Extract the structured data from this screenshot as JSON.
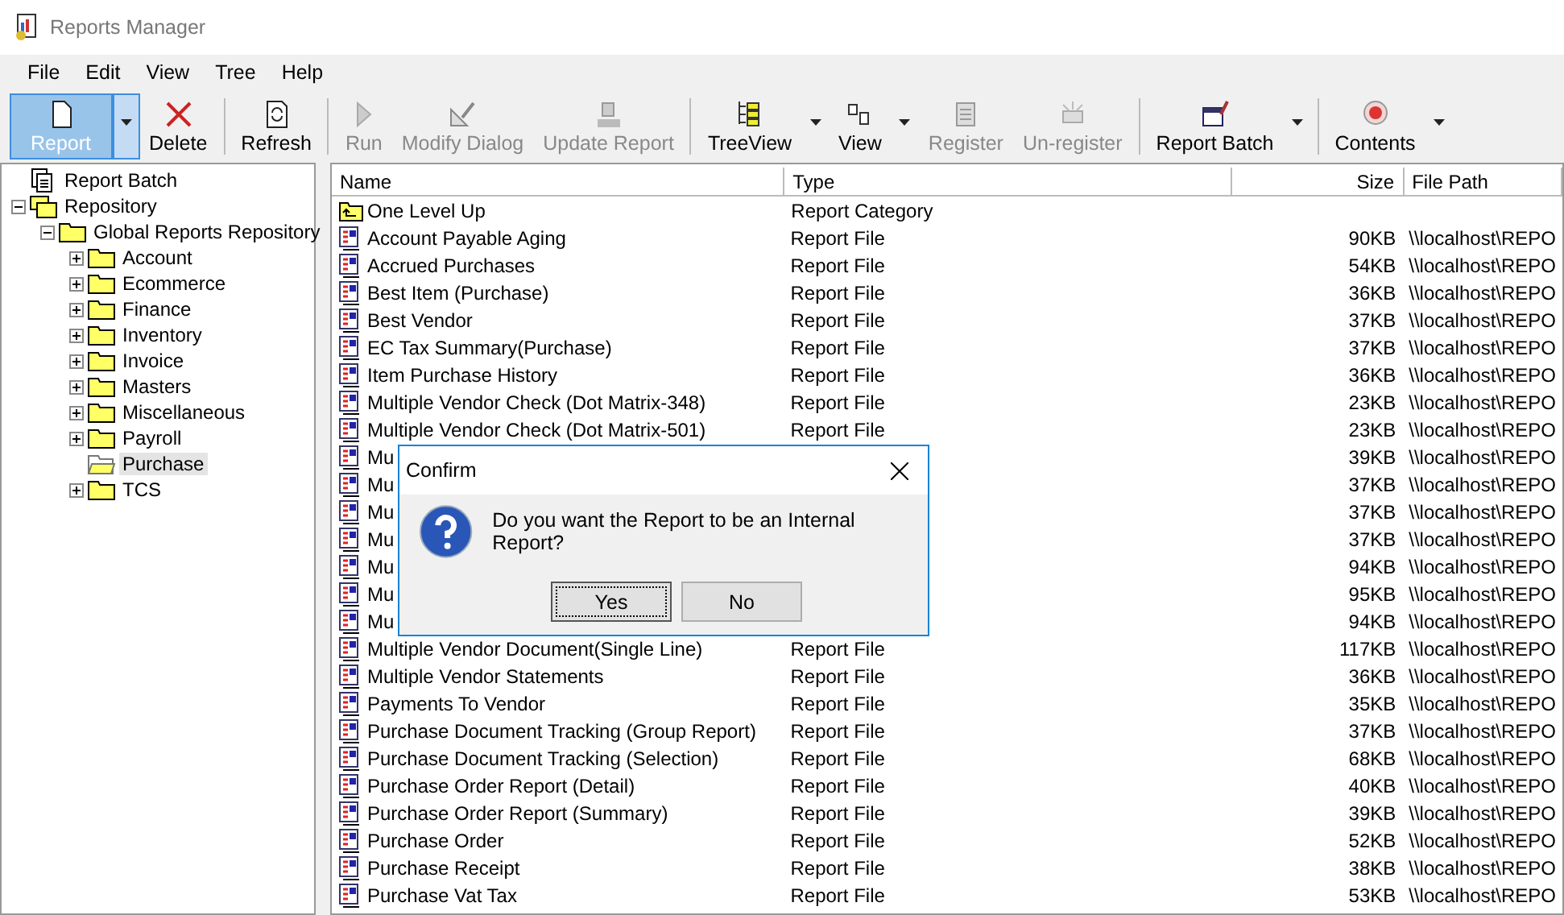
{
  "window": {
    "title": "Reports Manager"
  },
  "menu": [
    "File",
    "Edit",
    "View",
    "Tree",
    "Help"
  ],
  "toolbar": [
    [
      {
        "label": "Report",
        "disabled": false,
        "selected": true,
        "dropdown": true
      },
      {
        "label": "Delete",
        "disabled": false,
        "selected": false,
        "dropdown": false
      }
    ],
    [
      {
        "label": "Refresh",
        "disabled": false,
        "selected": false,
        "dropdown": false
      }
    ],
    [
      {
        "label": "Run",
        "disabled": true,
        "selected": false,
        "dropdown": false
      },
      {
        "label": "Modify Dialog",
        "disabled": true,
        "selected": false,
        "dropdown": false
      },
      {
        "label": "Update Report",
        "disabled": true,
        "selected": false,
        "dropdown": false
      }
    ],
    [
      {
        "label": "TreeView",
        "disabled": false,
        "selected": false,
        "dropdown": true
      },
      {
        "label": "View",
        "disabled": false,
        "selected": false,
        "dropdown": true
      },
      {
        "label": "Register",
        "disabled": true,
        "selected": false,
        "dropdown": false
      },
      {
        "label": "Un-register",
        "disabled": true,
        "selected": false,
        "dropdown": false
      }
    ],
    [
      {
        "label": "Report Batch",
        "disabled": false,
        "selected": false,
        "dropdown": true
      }
    ],
    [
      {
        "label": "Contents",
        "disabled": false,
        "selected": false,
        "dropdown": true
      }
    ]
  ],
  "tree": [
    {
      "label": "Report Batch",
      "kind": "batch",
      "selected": false
    },
    {
      "label": "Repository",
      "kind": "repository",
      "expanded": true,
      "selected": false,
      "children": [
        {
          "label": "Global Reports Repository",
          "kind": "folder",
          "expanded": true,
          "selected": false,
          "children": [
            {
              "label": "Account",
              "kind": "folder",
              "expanded": false,
              "selected": false
            },
            {
              "label": "Ecommerce",
              "kind": "folder",
              "expanded": false,
              "selected": false
            },
            {
              "label": "Finance",
              "kind": "folder",
              "expanded": false,
              "selected": false
            },
            {
              "label": "Inventory",
              "kind": "folder",
              "expanded": false,
              "selected": false
            },
            {
              "label": "Invoice",
              "kind": "folder",
              "expanded": false,
              "selected": false
            },
            {
              "label": "Masters",
              "kind": "folder",
              "expanded": false,
              "selected": false
            },
            {
              "label": "Miscellaneous",
              "kind": "folder",
              "expanded": false,
              "selected": false
            },
            {
              "label": "Payroll",
              "kind": "folder",
              "expanded": false,
              "selected": false
            },
            {
              "label": "Purchase",
              "kind": "folder",
              "expanded": true,
              "selected": true
            },
            {
              "label": "TCS",
              "kind": "folder",
              "expanded": false,
              "selected": false
            }
          ]
        }
      ]
    }
  ],
  "table": {
    "columns": [
      "Name",
      "Type",
      "Size",
      "File Path"
    ],
    "rows": [
      {
        "kind": "category",
        "name": "One Level Up",
        "type": "Report Category"
      },
      {
        "kind": "file",
        "name": "Account Payable Aging",
        "type": "Report File",
        "size": "90KB",
        "path": "\\\\localhost\\REPO"
      },
      {
        "kind": "file",
        "name": "Accrued Purchases",
        "type": "Report File",
        "size": "54KB",
        "path": "\\\\localhost\\REPO"
      },
      {
        "kind": "file",
        "name": "Best Item (Purchase)",
        "type": "Report File",
        "size": "36KB",
        "path": "\\\\localhost\\REPO"
      },
      {
        "kind": "file",
        "name": "Best Vendor",
        "type": "Report File",
        "size": "37KB",
        "path": "\\\\localhost\\REPO"
      },
      {
        "kind": "file",
        "name": "EC Tax Summary(Purchase)",
        "type": "Report File",
        "size": "37KB",
        "path": "\\\\localhost\\REPO"
      },
      {
        "kind": "file",
        "name": "Item Purchase History",
        "type": "Report File",
        "size": "36KB",
        "path": "\\\\localhost\\REPO"
      },
      {
        "kind": "file",
        "name": "Multiple Vendor Check (Dot Matrix-348)",
        "type": "Report File",
        "size": "23KB",
        "path": "\\\\localhost\\REPO"
      },
      {
        "kind": "file",
        "name": "Multiple Vendor Check (Dot Matrix-501)",
        "type": "Report File",
        "size": "23KB",
        "path": "\\\\localhost\\REPO"
      },
      {
        "kind": "file",
        "name": "Mu",
        "size": "39KB",
        "path": "\\\\localhost\\REPO"
      },
      {
        "kind": "file",
        "name": "Mu",
        "size": "37KB",
        "path": "\\\\localhost\\REPO"
      },
      {
        "kind": "file",
        "name": "Mu",
        "size": "37KB",
        "path": "\\\\localhost\\REPO"
      },
      {
        "kind": "file",
        "name": "Mu",
        "size": "37KB",
        "path": "\\\\localhost\\REPO"
      },
      {
        "kind": "file",
        "name": "Mu",
        "size": "94KB",
        "path": "\\\\localhost\\REPO"
      },
      {
        "kind": "file",
        "name": "Mu",
        "size": "95KB",
        "path": "\\\\localhost\\REPO"
      },
      {
        "kind": "file",
        "name": "Mu",
        "size": "94KB",
        "path": "\\\\localhost\\REPO"
      },
      {
        "kind": "file",
        "name": "Multiple Vendor Document(Single Line)",
        "type": "Report File",
        "size": "117KB",
        "path": "\\\\localhost\\REPO"
      },
      {
        "kind": "file",
        "name": "Multiple Vendor Statements",
        "type": "Report File",
        "size": "36KB",
        "path": "\\\\localhost\\REPO"
      },
      {
        "kind": "file",
        "name": "Payments To Vendor",
        "type": "Report File",
        "size": "35KB",
        "path": "\\\\localhost\\REPO"
      },
      {
        "kind": "file",
        "name": "Purchase Document Tracking (Group Report)",
        "type": "Report File",
        "size": "37KB",
        "path": "\\\\localhost\\REPO"
      },
      {
        "kind": "file",
        "name": "Purchase Document Tracking (Selection)",
        "type": "Report File",
        "size": "68KB",
        "path": "\\\\localhost\\REPO"
      },
      {
        "kind": "file",
        "name": "Purchase Order Report (Detail)",
        "type": "Report File",
        "size": "40KB",
        "path": "\\\\localhost\\REPO"
      },
      {
        "kind": "file",
        "name": "Purchase Order Report (Summary)",
        "type": "Report File",
        "size": "39KB",
        "path": "\\\\localhost\\REPO"
      },
      {
        "kind": "file",
        "name": "Purchase Order",
        "type": "Report File",
        "size": "52KB",
        "path": "\\\\localhost\\REPO"
      },
      {
        "kind": "file",
        "name": "Purchase Receipt",
        "type": "Report File",
        "size": "38KB",
        "path": "\\\\localhost\\REPO"
      },
      {
        "kind": "file",
        "name": "Purchase Vat Tax",
        "type": "Report File",
        "size": "53KB",
        "path": "\\\\localhost\\REPO"
      }
    ]
  },
  "dialog": {
    "title": "Confirm",
    "message": "Do you want the Report to be an Internal Report?",
    "buttons": [
      {
        "label": "Yes",
        "focused": true
      },
      {
        "label": "No",
        "focused": false
      }
    ]
  }
}
